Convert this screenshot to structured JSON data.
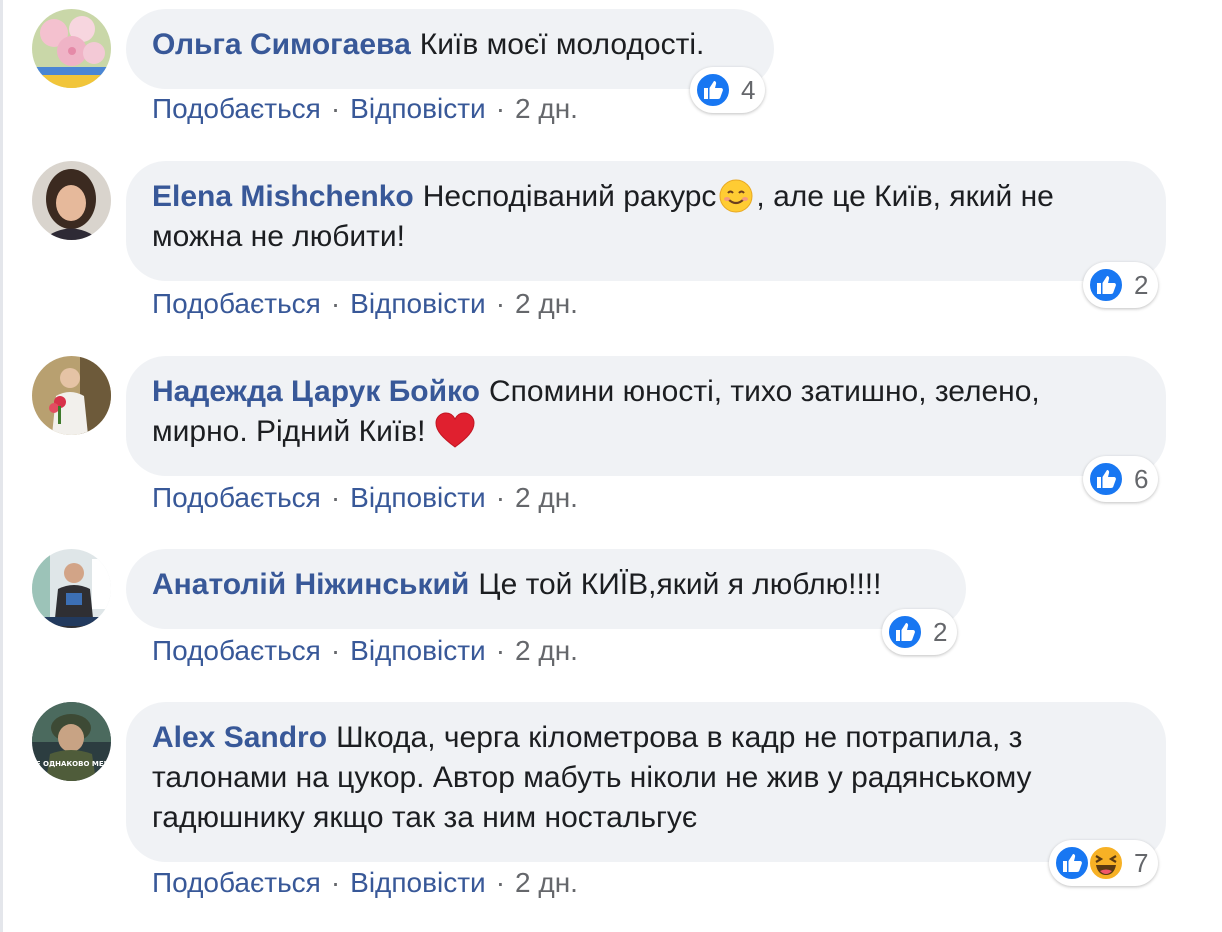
{
  "comments": [
    {
      "author": "Ольга Симогаева",
      "text": "Київ моєї молодості.",
      "reactions": {
        "icons": [
          "like-icon"
        ],
        "count": "4"
      },
      "actions": {
        "like": "Подобається",
        "reply": "Відповісти",
        "time": "2 дн."
      }
    },
    {
      "author": "Elena Mishchenko",
      "text_before_emoji": "Несподіваний ракурс",
      "emoji": "smiling-face-emoji",
      "text_after_emoji": ", але це Київ, який не можна не любити!",
      "reactions": {
        "icons": [
          "like-icon"
        ],
        "count": "2"
      },
      "actions": {
        "like": "Подобається",
        "reply": "Відповісти",
        "time": "2 дн."
      }
    },
    {
      "author": "Надежда Царук Бойко",
      "text": "Спомини юності, тихо затишно, зелено, мирно. Рідний Київ!",
      "emoji": "red-heart-emoji",
      "reactions": {
        "icons": [
          "like-icon"
        ],
        "count": "6"
      },
      "actions": {
        "like": "Подобається",
        "reply": "Відповісти",
        "time": "2 дн."
      }
    },
    {
      "author": "Анатолій Ніжинський",
      "text": "Це той КИЇВ,який я люблю!!!!",
      "reactions": {
        "icons": [
          "like-icon"
        ],
        "count": "2"
      },
      "actions": {
        "like": "Подобається",
        "reply": "Відповісти",
        "time": "2 дн."
      }
    },
    {
      "author": "Alex Sandro",
      "text": "Шкода, черга кілометрова в кадр не потрапила, з талонами на цукор. Автор мабуть ніколи не жив у радянському гадюшнику якщо так за ним ностальгує",
      "avatar_caption": "НЕ ОДНАКОВО МЕНІ",
      "reactions": {
        "icons": [
          "like-icon",
          "laughing-icon"
        ],
        "count": "7"
      },
      "actions": {
        "like": "Подобається",
        "reply": "Відповісти",
        "time": "2 дн."
      }
    }
  ],
  "colors": {
    "author": "#385898",
    "bubble": "#f0f2f5",
    "like": "#1877f2",
    "meta": "#65676b"
  }
}
